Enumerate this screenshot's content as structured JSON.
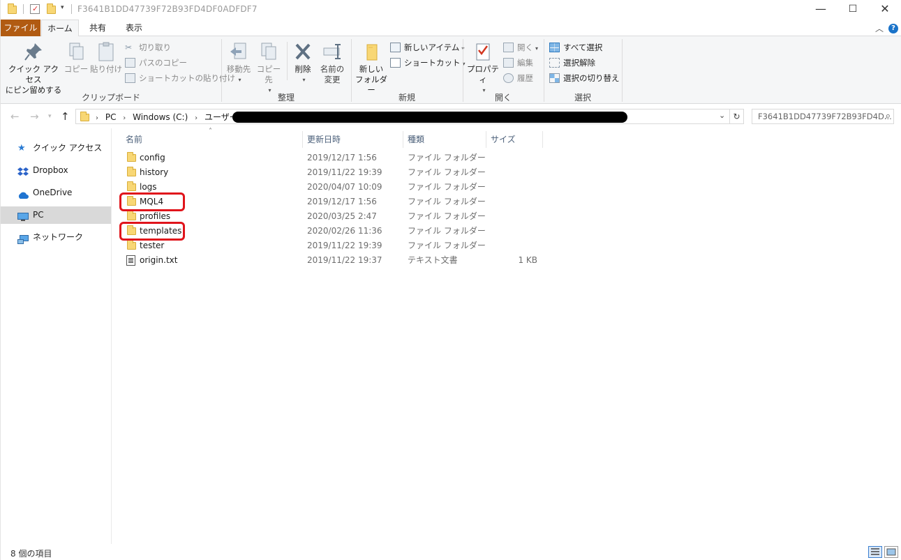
{
  "window": {
    "title": "F3641B1DD47739F72B93FD4DF0ADFDF7",
    "controls": {
      "minimize": "—",
      "maximize": "☐",
      "close": "✕"
    }
  },
  "ribbon": {
    "tabs": [
      "ファイル",
      "ホーム",
      "共有",
      "表示"
    ],
    "active_tab": "ホーム",
    "groups": {
      "clipboard": {
        "label": "クリップボード",
        "pin_line1": "クイック アクセス",
        "pin_line2": "にピン留めする",
        "copy": "コピー",
        "paste": "貼り付け",
        "cut": "切り取り",
        "copy_path": "パスのコピー",
        "paste_shortcut": "ショートカットの貼り付け"
      },
      "organize": {
        "label": "整理",
        "move_to": "移動先",
        "copy_to": "コピー先",
        "delete": "削除",
        "rename_line1": "名前の",
        "rename_line2": "変更"
      },
      "new": {
        "label": "新規",
        "new_folder_line1": "新しい",
        "new_folder_line2": "フォルダー",
        "new_item": "新しいアイテム",
        "easy_access": "ショートカット"
      },
      "open": {
        "label": "開く",
        "properties": "プロパティ",
        "open": "開く",
        "edit": "編集",
        "history": "履歴"
      },
      "select": {
        "label": "選択",
        "select_all": "すべて選択",
        "select_none": "選択解除",
        "invert": "選択の切り替え"
      }
    }
  },
  "address": {
    "crumbs": [
      "PC",
      "Windows (C:)",
      "ユーザー"
    ],
    "search_placeholder": "F3641B1DD47739F72B93FD4D..."
  },
  "nav_pane": {
    "items": [
      {
        "label": "クイック アクセス",
        "icon": "star-icon"
      },
      {
        "label": "Dropbox",
        "icon": "dropbox-icon"
      },
      {
        "label": "OneDrive",
        "icon": "cloud-icon"
      },
      {
        "label": "PC",
        "icon": "monitor-icon",
        "selected": true
      },
      {
        "label": "ネットワーク",
        "icon": "network-icon"
      }
    ]
  },
  "file_list": {
    "columns": {
      "name": "名前",
      "modified": "更新日時",
      "type": "種類",
      "size": "サイズ"
    },
    "rows": [
      {
        "name": "config",
        "modified": "2019/12/17 1:56",
        "type": "ファイル フォルダー",
        "size": "",
        "kind": "folder"
      },
      {
        "name": "history",
        "modified": "2019/11/22 19:39",
        "type": "ファイル フォルダー",
        "size": "",
        "kind": "folder"
      },
      {
        "name": "logs",
        "modified": "2020/04/07 10:09",
        "type": "ファイル フォルダー",
        "size": "",
        "kind": "folder"
      },
      {
        "name": "MQL4",
        "modified": "2019/12/17 1:56",
        "type": "ファイル フォルダー",
        "size": "",
        "kind": "folder",
        "highlighted": true
      },
      {
        "name": "profiles",
        "modified": "2020/03/25 2:47",
        "type": "ファイル フォルダー",
        "size": "",
        "kind": "folder"
      },
      {
        "name": "templates",
        "modified": "2020/02/26 11:36",
        "type": "ファイル フォルダー",
        "size": "",
        "kind": "folder",
        "highlighted": true
      },
      {
        "name": "tester",
        "modified": "2019/11/22 19:39",
        "type": "ファイル フォルダー",
        "size": "",
        "kind": "folder"
      },
      {
        "name": "origin.txt",
        "modified": "2019/11/22 19:37",
        "type": "テキスト文書",
        "size": "1 KB",
        "kind": "text"
      }
    ],
    "highlight_color": "#e0141b"
  },
  "status_bar": {
    "item_count": "8 個の項目"
  },
  "colors": {
    "file_tab": "#b15b12",
    "folder": "#f8d775",
    "selection": "#d9d9d9"
  }
}
